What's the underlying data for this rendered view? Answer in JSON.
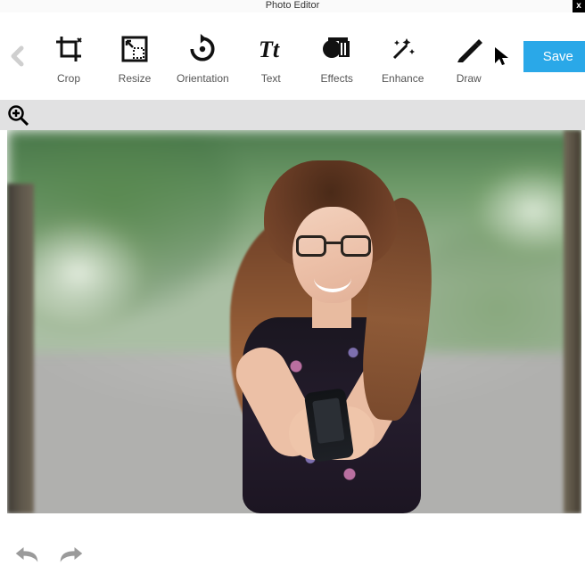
{
  "app": {
    "title": "Photo Editor",
    "close": "x"
  },
  "toolbar": {
    "tools": [
      {
        "id": "crop",
        "label": "Crop"
      },
      {
        "id": "resize",
        "label": "Resize"
      },
      {
        "id": "orientation",
        "label": "Orientation"
      },
      {
        "id": "text",
        "label": "Text"
      },
      {
        "id": "effects",
        "label": "Effects"
      },
      {
        "id": "enhance",
        "label": "Enhance"
      },
      {
        "id": "draw",
        "label": "Draw"
      }
    ],
    "save": "Save"
  }
}
